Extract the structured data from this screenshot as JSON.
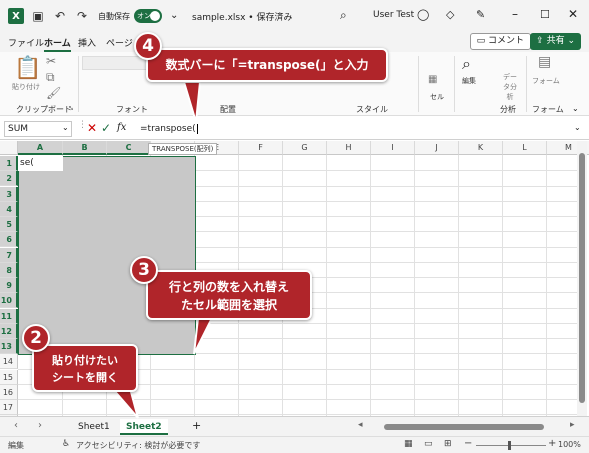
{
  "titlebar": {
    "autosave_label": "自動保存",
    "autosave_state": "オン",
    "filename": "sample.xlsx • 保存済み",
    "user": "User Test"
  },
  "tabs": [
    "ファイル",
    "ホーム",
    "挿入",
    "ページ"
  ],
  "ribbon_buttons": {
    "comment": "コメント",
    "share": "共有"
  },
  "ribbon_groups": {
    "paste_label": "貼り付け",
    "clipboard": "クリップボード",
    "font": "フォント",
    "alignment": "配置",
    "style": "スタイル",
    "cell": "セル",
    "editing": "編集",
    "analysis_btn": "データ分析",
    "analysis": "分析",
    "form_btn": "フォーム",
    "form": "フォーム"
  },
  "formula_bar": {
    "name_box": "SUM",
    "formula": "=transpose(",
    "fx": "fx",
    "tooltip": "TRANSPOSE(配列)"
  },
  "grid": {
    "columns": [
      "A",
      "B",
      "C",
      "D",
      "E",
      "F",
      "G",
      "H",
      "I",
      "J",
      "K",
      "L",
      "M"
    ],
    "rows": [
      "1",
      "2",
      "3",
      "4",
      "5",
      "6",
      "7",
      "8",
      "9",
      "10",
      "11",
      "12",
      "13",
      "14",
      "15",
      "16",
      "17",
      "18"
    ],
    "active_cell_text": "se("
  },
  "sheets": {
    "tab1": "Sheet1",
    "tab2": "Sheet2",
    "add": "+"
  },
  "status": {
    "mode": "編集",
    "accessibility": "アクセシビリティ: 検討が必要です",
    "zoom": "100%"
  },
  "callouts": {
    "c4": {
      "num": "4",
      "text": "数式バーに「=transpose(」と入力"
    },
    "c3": {
      "num": "3",
      "line1": "行と列の数を入れ替え",
      "line2": "たセル範囲を選択"
    },
    "c2": {
      "num": "2",
      "line1": "貼り付けたい",
      "line2": "シートを開く"
    }
  },
  "colors": {
    "accent": "#1d6f42",
    "callout": "#b0252a"
  }
}
